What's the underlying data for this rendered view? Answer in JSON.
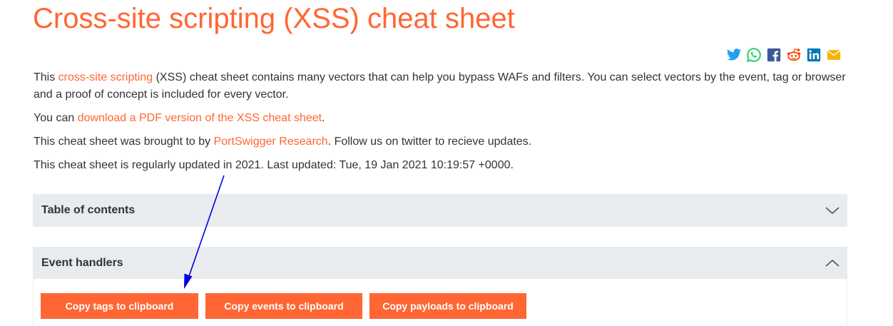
{
  "header": {
    "title": "Cross-site scripting (XSS) cheat sheet"
  },
  "share": {
    "icons": [
      "twitter-icon",
      "whatsapp-icon",
      "facebook-icon",
      "reddit-icon",
      "linkedin-icon",
      "email-icon"
    ],
    "colors": {
      "twitter": "#1da1f2",
      "whatsapp": "#25d366",
      "facebook": "#3b5998",
      "reddit": "#ff4500",
      "linkedin": "#0077b5",
      "email": "#f5b400"
    }
  },
  "intro": {
    "p1_prefix": "This ",
    "p1_link": "cross-site scripting",
    "p1_suffix": " (XSS) cheat sheet contains many vectors that can help you bypass WAFs and filters. You can select vectors by the event, tag or browser and a proof of concept is included for every vector.",
    "p2_prefix": "You can ",
    "p2_link": "download a PDF version of the XSS cheat sheet",
    "p2_suffix": ".",
    "p3_prefix": "This cheat sheet was brought to by ",
    "p3_link": "PortSwigger Research",
    "p3_suffix": ". Follow us on twitter to recieve updates.",
    "p4": "This cheat sheet is regularly updated in 2021. Last updated: Tue, 19 Jan 2021 10:19:57 +0000."
  },
  "sections": {
    "toc": {
      "title": "Table of contents",
      "state": "collapsed"
    },
    "events": {
      "title": "Event handlers",
      "state": "expanded"
    }
  },
  "buttons": {
    "copy_tags": "Copy tags to clipboard",
    "copy_events": "Copy events to clipboard",
    "copy_payloads": "Copy payloads to clipboard"
  },
  "colors": {
    "accent": "#ff6633",
    "section_bg": "#e8ecef",
    "annotation": "#0000e0"
  }
}
